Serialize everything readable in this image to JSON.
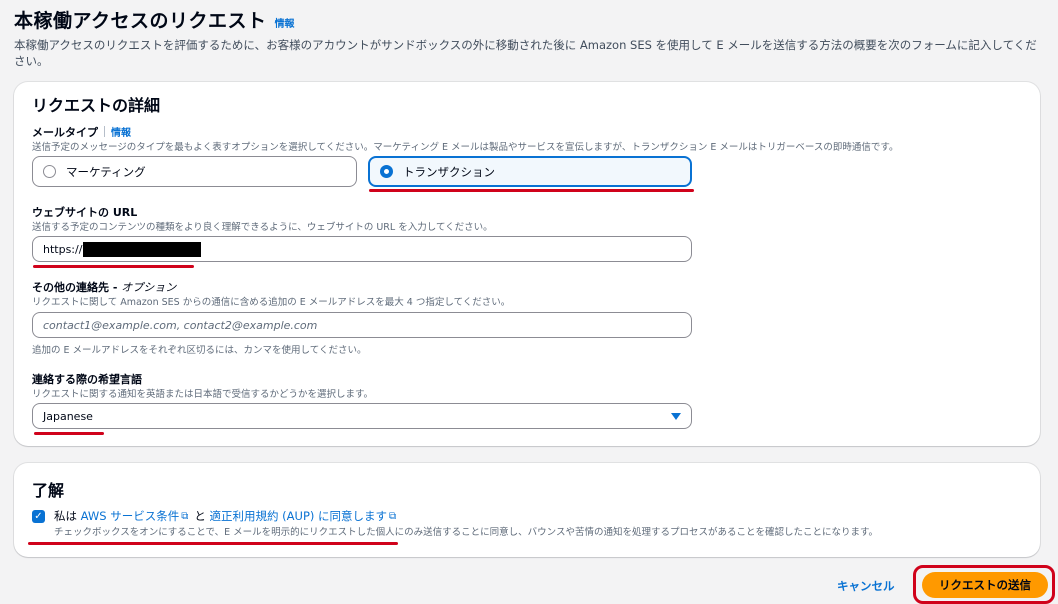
{
  "header": {
    "title": "本稼働アクセスのリクエスト",
    "info": "情報",
    "description": "本稼働アクセスのリクエストを評価するために、お客様のアカウントがサンドボックスの外に移動された後に Amazon SES を使用して E メールを送信する方法の概要を次のフォームに記入してください。"
  },
  "details": {
    "title": "リクエストの詳細",
    "mail_type": {
      "label": "メールタイプ",
      "info": "情報",
      "description": "送信予定のメッセージのタイプを最もよく表すオプションを選択してください。マーケティング E メールは製品やサービスを宣伝しますが、トランザクション E メールはトリガーベースの即時通信です。",
      "options": [
        "マーケティング",
        "トランザクション"
      ],
      "selected": "トランザクション"
    },
    "website": {
      "label": "ウェブサイトの URL",
      "description": "送信する予定のコンテンツの種類をより良く理解できるように、ウェブサイトの URL を入力してください。",
      "value": "https://"
    },
    "contacts": {
      "label": "その他の連絡先",
      "optional": "オプション",
      "description": "リクエストに関して Amazon SES からの通信に含める追加の E メールアドレスを最大 4 つ指定してください。",
      "placeholder": "contact1@example.com, contact2@example.com",
      "hint": "追加の E メールアドレスをそれぞれ区切るには、カンマを使用してください。"
    },
    "language": {
      "label": "連絡する際の希望言語",
      "description": "リクエストに関する通知を英語または日本語で受信するかどうかを選択します。",
      "value": "Japanese"
    }
  },
  "acknowledge": {
    "title": "了解",
    "prefix": "私は",
    "link1": "AWS サービス条件",
    "conj": "と",
    "link2": "適正利用規約 (AUP) に同意します",
    "description": "チェックボックスをオンにすることで、E メールを明示的にリクエストした個人にのみ送信することに同意し、バウンスや苦情の通知を処理するプロセスがあることを確認したことになります。",
    "checked": true
  },
  "actions": {
    "cancel": "キャンセル",
    "submit": "リクエストの送信"
  },
  "colors": {
    "accent": "#0972d3",
    "primary_button": "#ff9900",
    "annotation": "#d0021b"
  }
}
